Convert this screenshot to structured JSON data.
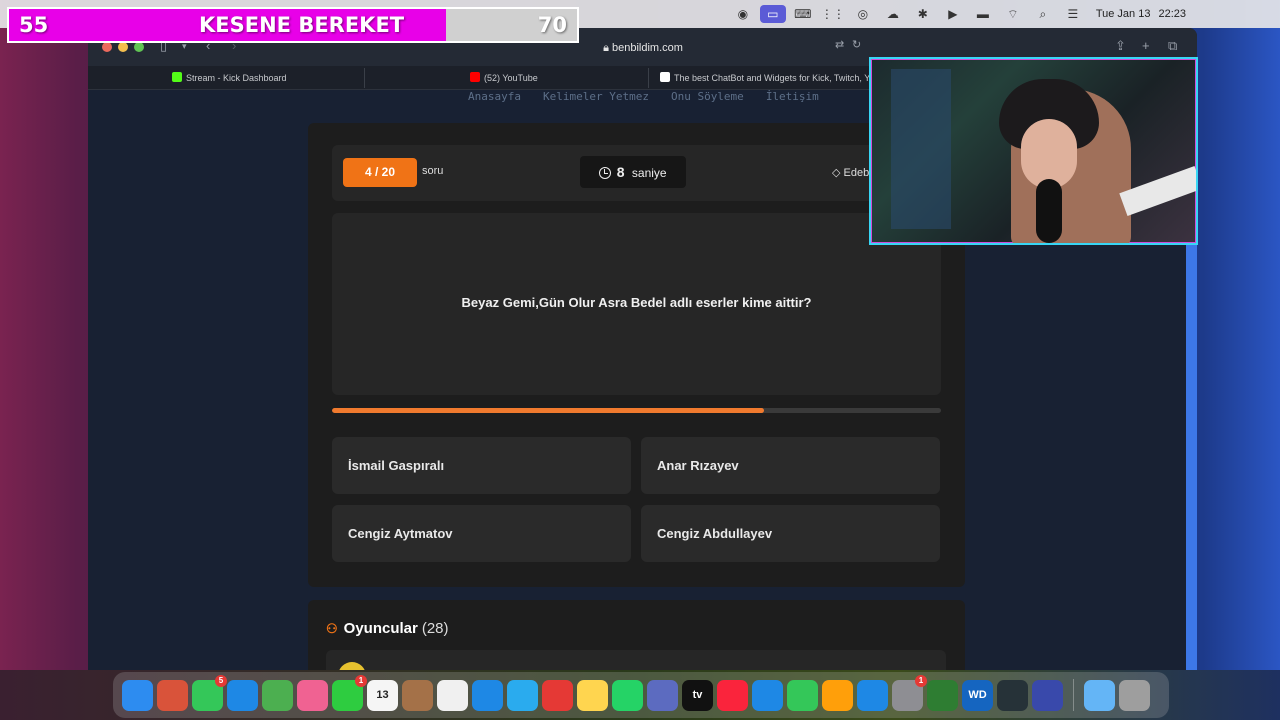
{
  "overlay": {
    "left_value": "55",
    "title": "KESENE BEREKET",
    "right_value": "70",
    "fill_fraction": 0.77
  },
  "menubar": {
    "date": "Tue Jan 13",
    "time": "22:23",
    "icons": [
      "screen-record-icon",
      "screen-share-icon",
      "keyboard-icon",
      "grid-icon",
      "app-icon",
      "cloud-icon",
      "bluetooth-icon",
      "play-icon",
      "battery-icon",
      "wifi-icon",
      "search-icon",
      "control-center-icon"
    ]
  },
  "browser": {
    "url": "benbildim.com",
    "tabs": [
      {
        "title": "Stream - Kick Dashboard",
        "favicon_color": "#53fc18"
      },
      {
        "title": "(52) YouTube",
        "favicon_color": "#ff0000"
      },
      {
        "title": "The best ChatBot and Widgets for Kick, Twitch, YouTube",
        "favicon_color": "#ffffff"
      }
    ]
  },
  "site": {
    "nav": [
      "Anasayfa",
      "Kelimeler Yetmez",
      "Onu Söyleme",
      "İletişim"
    ]
  },
  "quiz": {
    "counter": "4 / 20",
    "counter_suffix": "soru",
    "timer_value": "8",
    "timer_unit": "saniye",
    "category": "Edeb",
    "question": "Beyaz Gemi,Gün Olur Asra Bedel adlı eserler kime aittir?",
    "progress_fraction": 0.71,
    "answers": [
      "İsmail Gaspıralı",
      "Anar Rızayev",
      "Cengiz Aytmatov",
      "Cengiz Abdullayev"
    ]
  },
  "players": {
    "title": "Oyuncular",
    "count": "(28)"
  },
  "dock": {
    "items": [
      {
        "name": "finder",
        "color": "#2d8cf0"
      },
      {
        "name": "launchpad",
        "color": "#d9533a"
      },
      {
        "name": "messages",
        "color": "#34c759",
        "badge": "5"
      },
      {
        "name": "mail",
        "color": "#1e88e5"
      },
      {
        "name": "maps",
        "color": "#4caf50"
      },
      {
        "name": "photos",
        "color": "#f06292"
      },
      {
        "name": "facetime",
        "color": "#2ecc40",
        "badge": "1"
      },
      {
        "name": "calendar",
        "color": "#f5f5f5",
        "label": "13"
      },
      {
        "name": "contacts",
        "color": "#a47148"
      },
      {
        "name": "reminders",
        "color": "#f0f0f0"
      },
      {
        "name": "safari",
        "color": "#1e88e5"
      },
      {
        "name": "telegram",
        "color": "#2aabee"
      },
      {
        "name": "chrome",
        "color": "#e53935"
      },
      {
        "name": "notes",
        "color": "#ffd54f"
      },
      {
        "name": "whatsapp",
        "color": "#25d366"
      },
      {
        "name": "freeform",
        "color": "#5c6bc0"
      },
      {
        "name": "tv",
        "color": "#111111",
        "label": "tv"
      },
      {
        "name": "music",
        "color": "#fa243c"
      },
      {
        "name": "keynote",
        "color": "#1e88e5"
      },
      {
        "name": "numbers",
        "color": "#34c759"
      },
      {
        "name": "pages",
        "color": "#ff9f0a"
      },
      {
        "name": "app-store",
        "color": "#1e88e5"
      },
      {
        "name": "system-settings",
        "color": "#8e8e93",
        "badge": "1"
      },
      {
        "name": "xcode",
        "color": "#2e7d32"
      },
      {
        "name": "wd-discovery",
        "color": "#1565c0",
        "label": "WD"
      },
      {
        "name": "obs",
        "color": "#263238"
      },
      {
        "name": "screen-capture",
        "color": "#3949ab"
      },
      {
        "name": "downloads-folder",
        "color": "#64b5f6"
      },
      {
        "name": "trash",
        "color": "#9e9e9e"
      }
    ]
  }
}
